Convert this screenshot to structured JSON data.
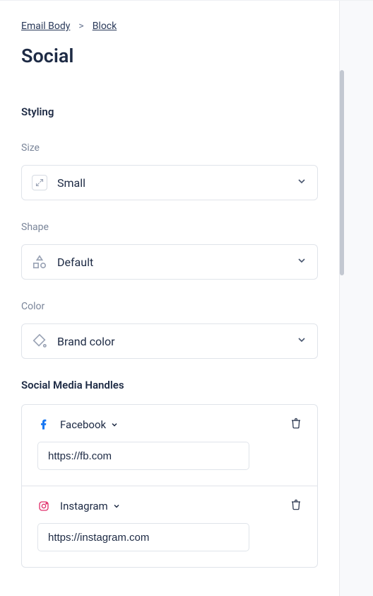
{
  "breadcrumb": {
    "root": "Email Body",
    "current": "Block"
  },
  "title": "Social",
  "sections": {
    "styling": "Styling",
    "handles": "Social Media Handles"
  },
  "fields": {
    "size": {
      "label": "Size",
      "value": "Small"
    },
    "shape": {
      "label": "Shape",
      "value": "Default"
    },
    "color": {
      "label": "Color",
      "value": "Brand color"
    }
  },
  "handles": [
    {
      "brand": "Facebook",
      "url": "https://fb.com",
      "brand_color": "#1877F2"
    },
    {
      "brand": "Instagram",
      "url": "https://instagram.com",
      "brand_color": "#E1306C"
    }
  ]
}
